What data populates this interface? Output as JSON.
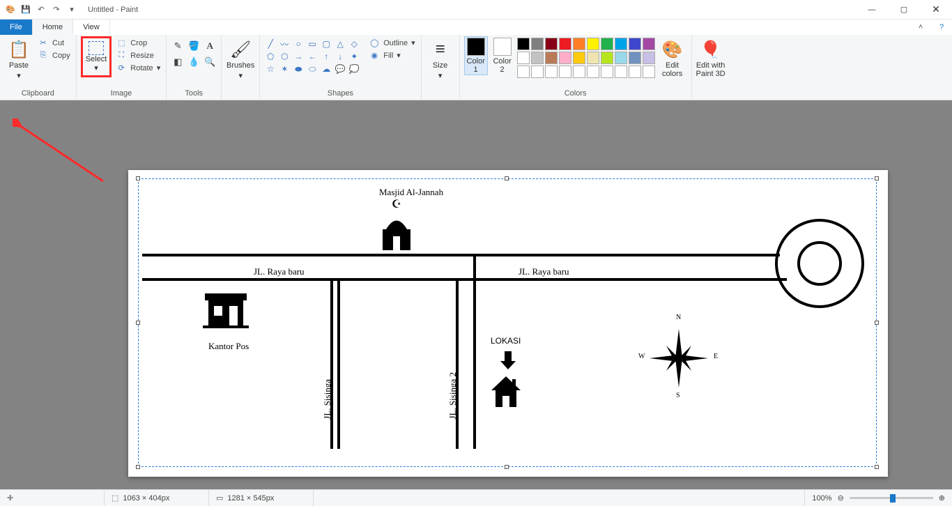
{
  "title": "Untitled - Paint",
  "tabs": {
    "file": "File",
    "home": "Home",
    "view": "View"
  },
  "clipboard": {
    "group": "Clipboard",
    "paste": "Paste",
    "cut": "Cut",
    "copy": "Copy"
  },
  "image": {
    "group": "Image",
    "select": "Select",
    "crop": "Crop",
    "resize": "Resize",
    "rotate": "Rotate"
  },
  "tools": {
    "group": "Tools"
  },
  "brushes": {
    "group": "",
    "label": "Brushes"
  },
  "shapes": {
    "group": "Shapes",
    "outline": "Outline",
    "fill": "Fill"
  },
  "size": {
    "label": "Size"
  },
  "colors": {
    "group": "Colors",
    "c1": "Color\n1",
    "c2": "Color\n2",
    "edit": "Edit\ncolors",
    "palette_row1": [
      "#000000",
      "#7f7f7f",
      "#880015",
      "#ed1c24",
      "#ff7f27",
      "#fff200",
      "#22b14c",
      "#00a2e8",
      "#3f48cc",
      "#a349a4"
    ],
    "palette_row2": [
      "#ffffff",
      "#c3c3c3",
      "#b97a57",
      "#ffaec9",
      "#ffc90e",
      "#efe4b0",
      "#b5e61d",
      "#99d9ea",
      "#7092be",
      "#c8bfe7"
    ],
    "palette_row3": [
      "#ffffff",
      "#ffffff",
      "#ffffff",
      "#ffffff",
      "#ffffff",
      "#ffffff",
      "#ffffff",
      "#ffffff",
      "#ffffff",
      "#ffffff"
    ]
  },
  "paint3d": {
    "label": "Edit with\nPaint 3D"
  },
  "status": {
    "pos": "",
    "sel": "1063 × 404px",
    "canvas": "1281 × 545px",
    "zoom": "100%"
  },
  "map": {
    "mosque": "Masjid Al-Jannah",
    "road1": "JL. Raya baru",
    "road2": "JL. Raya baru",
    "road3": "JL. Sisinga",
    "road4": "JL. Sisinga 2",
    "post": "Kantor Pos",
    "lokasi": "LOKASI",
    "n": "N",
    "e": "E",
    "s": "S",
    "w": "W"
  }
}
